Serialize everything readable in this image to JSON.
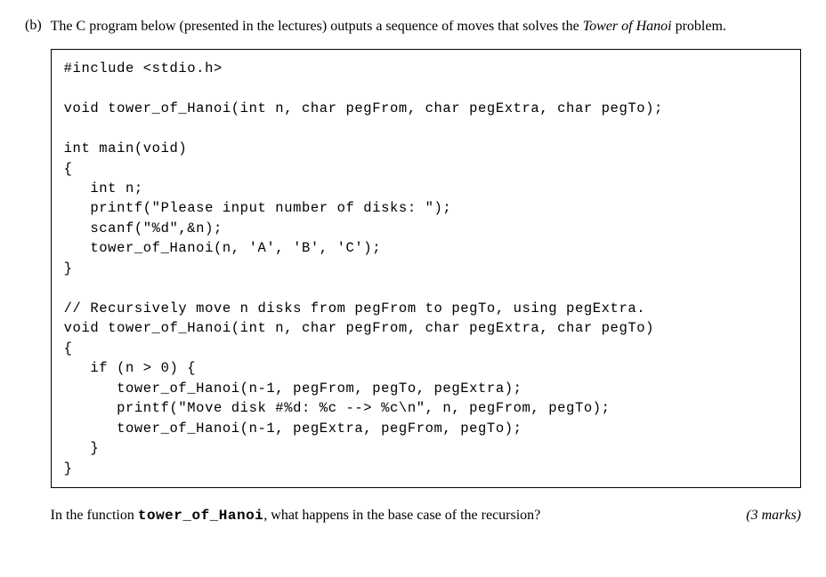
{
  "marker": "(b)",
  "intro": {
    "part1": "The C program below (presented in the lectures) outputs a sequence of moves that solves the ",
    "italic": "Tower of Hanoi",
    "part2": " problem."
  },
  "code": "#include <stdio.h>\n\nvoid tower_of_Hanoi(int n, char pegFrom, char pegExtra, char pegTo);\n\nint main(void)\n{\n   int n;\n   printf(\"Please input number of disks: \");\n   scanf(\"%d\",&n);\n   tower_of_Hanoi(n, 'A', 'B', 'C');\n}\n\n// Recursively move n disks from pegFrom to pegTo, using pegExtra.\nvoid tower_of_Hanoi(int n, char pegFrom, char pegExtra, char pegTo)\n{\n   if (n > 0) {\n      tower_of_Hanoi(n-1, pegFrom, pegTo, pegExtra);\n      printf(\"Move disk #%d: %c --> %c\\n\", n, pegFrom, pegTo);\n      tower_of_Hanoi(n-1, pegExtra, pegFrom, pegTo);\n   }\n}",
  "question": {
    "before": "In the function ",
    "func": "tower_of_Hanoi",
    "after": ", what happens in the base case of the recursion?"
  },
  "marks": "(3 marks)"
}
